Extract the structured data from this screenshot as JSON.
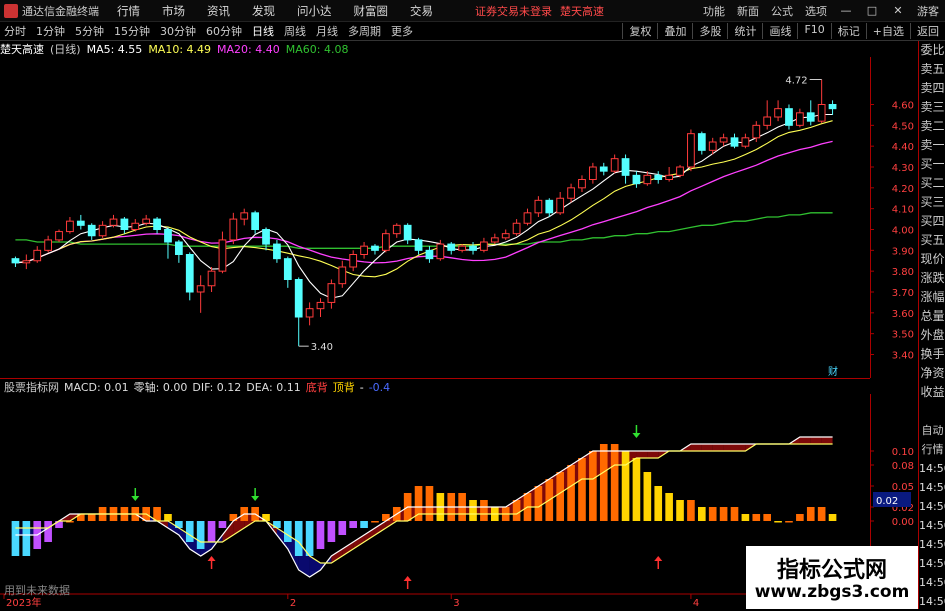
{
  "titlebar": {
    "app_title": "通达信金融终端",
    "menu": [
      "行情",
      "市场",
      "资讯",
      "发现",
      "问小达",
      "财富圈",
      "交易"
    ],
    "warning": "证券交易未登录",
    "warning2": "楚天高速",
    "right": [
      "功能",
      "新面",
      "公式",
      "选项"
    ],
    "guest": "游客",
    "win_min": "—",
    "win_max": "□",
    "win_close": "✕"
  },
  "toolbar": {
    "periods": [
      "分时",
      "1分钟",
      "5分钟",
      "15分钟",
      "30分钟",
      "60分钟",
      "日线",
      "周线",
      "月线",
      "多周期",
      "更多"
    ],
    "active_period": "日线",
    "right": [
      "复权",
      "叠加",
      "多股",
      "统计",
      "画线",
      "F10",
      "标记",
      "+自选",
      "返回"
    ]
  },
  "infobar": {
    "stock": "楚天高速",
    "period": "(日线)",
    "ma5": "MA5: 4.55",
    "ma10": "MA10: 4.49",
    "ma20": "MA20: 4.40",
    "ma60": "MA60: 4.08"
  },
  "indicator_bar": {
    "name": "股票指标网",
    "macd": "MACD: 0.01",
    "zero": "零轴: 0.00",
    "dif": "DIF: 0.12",
    "dea": "DEA: 0.11",
    "lbl1": "底背",
    "lbl2": "顶背",
    "lbl3": "-",
    "lbl4": "-0.4"
  },
  "rightcol": [
    "委比",
    "卖五",
    "卖四",
    "卖三",
    "卖二",
    "卖一",
    "买一",
    "买二",
    "买三",
    "买四",
    "买五",
    "现价",
    "涨跌",
    "涨幅",
    "总量",
    "外盘",
    "换手",
    "净资",
    "收益",
    "",
    "自动",
    "行情",
    "14:50",
    "14:50",
    "14:50",
    "14:50",
    "14:50",
    "14:50",
    "14:50",
    "14:50"
  ],
  "price_axis": [
    "4.60",
    "4.50",
    "4.40",
    "4.30",
    "4.20",
    "4.10",
    "4.00",
    "3.90",
    "3.80",
    "3.70",
    "3.60",
    "3.50",
    "3.40"
  ],
  "macd_axis": [
    "0.10",
    "0.08",
    "0.05",
    "0.02",
    "0.00"
  ],
  "macd_current": "0.02",
  "annotations": {
    "high": "4.72",
    "low": "3.40",
    "fin": "财"
  },
  "date_axis": [
    "2023年",
    "2",
    "3",
    "4"
  ],
  "footnote": "用到未来数据",
  "watermark": {
    "line1": "指标公式网",
    "line2": "www.zbgs3.com"
  },
  "colors": {
    "up": "#ff3b3b",
    "down": "#54ffff",
    "ma5": "#ffffff",
    "ma10": "#ffff55",
    "ma20": "#ff40ff",
    "ma60": "#30c030",
    "macd_up": "#ff6a00",
    "macd_up2": "#ffd400",
    "macd_dn": "#4ad8ff",
    "macd_dn2": "#c050ff"
  },
  "chart_data": {
    "type": "candlestick",
    "ylim": [
      3.34,
      4.78
    ],
    "candles": [
      [
        3.86,
        3.84,
        3.87,
        3.82
      ],
      [
        3.84,
        3.85,
        3.88,
        3.81
      ],
      [
        3.85,
        3.9,
        3.92,
        3.84
      ],
      [
        3.9,
        3.95,
        3.97,
        3.89
      ],
      [
        3.95,
        3.99,
        4.0,
        3.94
      ],
      [
        3.99,
        4.04,
        4.06,
        3.98
      ],
      [
        4.04,
        4.02,
        4.07,
        4.0
      ],
      [
        4.02,
        3.97,
        4.03,
        3.95
      ],
      [
        3.97,
        4.02,
        4.04,
        3.96
      ],
      [
        4.02,
        4.05,
        4.07,
        4.01
      ],
      [
        4.05,
        4.0,
        4.06,
        3.98
      ],
      [
        4.0,
        4.03,
        4.05,
        3.99
      ],
      [
        4.03,
        4.05,
        4.07,
        4.02
      ],
      [
        4.05,
        4.0,
        4.06,
        3.98
      ],
      [
        4.0,
        3.94,
        4.01,
        3.86
      ],
      [
        3.94,
        3.88,
        3.95,
        3.84
      ],
      [
        3.88,
        3.7,
        3.89,
        3.66
      ],
      [
        3.7,
        3.73,
        3.78,
        3.6
      ],
      [
        3.73,
        3.8,
        3.82,
        3.7
      ],
      [
        3.8,
        3.95,
        3.99,
        3.79
      ],
      [
        3.95,
        4.05,
        4.08,
        3.93
      ],
      [
        4.05,
        4.08,
        4.1,
        4.02
      ],
      [
        4.08,
        4.0,
        4.09,
        3.98
      ],
      [
        4.0,
        3.93,
        4.01,
        3.9
      ],
      [
        3.93,
        3.86,
        3.95,
        3.84
      ],
      [
        3.86,
        3.76,
        3.87,
        3.72
      ],
      [
        3.76,
        3.58,
        3.77,
        3.44
      ],
      [
        3.58,
        3.62,
        3.65,
        3.54
      ],
      [
        3.62,
        3.65,
        3.67,
        3.58
      ],
      [
        3.65,
        3.74,
        3.76,
        3.62
      ],
      [
        3.74,
        3.82,
        3.85,
        3.72
      ],
      [
        3.82,
        3.88,
        3.9,
        3.8
      ],
      [
        3.88,
        3.92,
        3.94,
        3.86
      ],
      [
        3.92,
        3.9,
        3.93,
        3.88
      ],
      [
        3.9,
        3.98,
        4.0,
        3.89
      ],
      [
        3.98,
        4.02,
        4.03,
        3.96
      ],
      [
        4.02,
        3.95,
        4.03,
        3.93
      ],
      [
        3.95,
        3.9,
        3.96,
        3.88
      ],
      [
        3.9,
        3.86,
        3.92,
        3.84
      ],
      [
        3.86,
        3.93,
        3.95,
        3.85
      ],
      [
        3.93,
        3.9,
        3.94,
        3.88
      ],
      [
        3.9,
        3.92,
        3.93,
        3.89
      ],
      [
        3.92,
        3.9,
        3.94,
        3.88
      ],
      [
        3.9,
        3.94,
        3.96,
        3.89
      ],
      [
        3.94,
        3.96,
        3.98,
        3.93
      ],
      [
        3.96,
        3.98,
        4.0,
        3.95
      ],
      [
        3.98,
        4.03,
        4.05,
        3.97
      ],
      [
        4.03,
        4.08,
        4.1,
        4.02
      ],
      [
        4.08,
        4.14,
        4.16,
        4.06
      ],
      [
        4.14,
        4.08,
        4.15,
        4.06
      ],
      [
        4.08,
        4.15,
        4.18,
        4.07
      ],
      [
        4.15,
        4.2,
        4.22,
        4.13
      ],
      [
        4.2,
        4.24,
        4.26,
        4.18
      ],
      [
        4.24,
        4.3,
        4.32,
        4.22
      ],
      [
        4.3,
        4.28,
        4.32,
        4.26
      ],
      [
        4.28,
        4.34,
        4.36,
        4.27
      ],
      [
        4.34,
        4.26,
        4.36,
        4.22
      ],
      [
        4.26,
        4.22,
        4.28,
        4.2
      ],
      [
        4.22,
        4.26,
        4.28,
        4.21
      ],
      [
        4.26,
        4.24,
        4.28,
        4.22
      ],
      [
        4.24,
        4.26,
        4.3,
        4.23
      ],
      [
        4.26,
        4.3,
        4.31,
        4.25
      ],
      [
        4.3,
        4.46,
        4.48,
        4.28
      ],
      [
        4.46,
        4.38,
        4.47,
        4.36
      ],
      [
        4.38,
        4.42,
        4.44,
        4.36
      ],
      [
        4.42,
        4.44,
        4.46,
        4.4
      ],
      [
        4.44,
        4.4,
        4.46,
        4.39
      ],
      [
        4.4,
        4.44,
        4.46,
        4.39
      ],
      [
        4.44,
        4.5,
        4.52,
        4.42
      ],
      [
        4.5,
        4.54,
        4.62,
        4.48
      ],
      [
        4.54,
        4.58,
        4.62,
        4.52
      ],
      [
        4.58,
        4.5,
        4.6,
        4.48
      ],
      [
        4.5,
        4.56,
        4.58,
        4.49
      ],
      [
        4.56,
        4.52,
        4.62,
        4.5
      ],
      [
        4.52,
        4.6,
        4.72,
        4.51
      ],
      [
        4.6,
        4.58,
        4.62,
        4.55
      ]
    ],
    "ma60": [
      3.95,
      3.95,
      3.94,
      3.94,
      3.94,
      3.94,
      3.93,
      3.93,
      3.93,
      3.93,
      3.93,
      3.93,
      3.93,
      3.93,
      3.93,
      3.92,
      3.92,
      3.92,
      3.92,
      3.92,
      3.92,
      3.92,
      3.92,
      3.92,
      3.92,
      3.92,
      3.91,
      3.91,
      3.91,
      3.91,
      3.91,
      3.91,
      3.91,
      3.91,
      3.92,
      3.92,
      3.92,
      3.92,
      3.92,
      3.92,
      3.92,
      3.92,
      3.92,
      3.93,
      3.93,
      3.93,
      3.93,
      3.93,
      3.94,
      3.94,
      3.94,
      3.95,
      3.95,
      3.96,
      3.96,
      3.97,
      3.97,
      3.98,
      3.98,
      3.99,
      3.99,
      4.0,
      4.01,
      4.02,
      4.02,
      4.03,
      4.04,
      4.04,
      4.05,
      4.06,
      4.06,
      4.07,
      4.07,
      4.08,
      4.08,
      4.08
    ],
    "macd": [
      -0.05,
      -0.05,
      -0.04,
      -0.03,
      -0.01,
      0.0,
      0.01,
      0.01,
      0.02,
      0.02,
      0.02,
      0.02,
      0.02,
      0.02,
      0.01,
      -0.01,
      -0.03,
      -0.04,
      -0.03,
      -0.01,
      0.01,
      0.02,
      0.02,
      0.01,
      -0.01,
      -0.03,
      -0.05,
      -0.05,
      -0.04,
      -0.03,
      -0.02,
      -0.01,
      -0.01,
      0.0,
      0.01,
      0.02,
      0.04,
      0.05,
      0.05,
      0.04,
      0.04,
      0.04,
      0.03,
      0.03,
      0.02,
      0.02,
      0.03,
      0.04,
      0.05,
      0.06,
      0.07,
      0.08,
      0.09,
      0.1,
      0.11,
      0.11,
      0.1,
      0.09,
      0.07,
      0.05,
      0.04,
      0.03,
      0.03,
      0.02,
      0.02,
      0.02,
      0.02,
      0.01,
      0.01,
      0.01,
      0.0,
      0.0,
      0.01,
      0.02,
      0.02,
      0.01
    ],
    "dif": [
      -0.02,
      -0.02,
      -0.02,
      -0.01,
      0.0,
      0.01,
      0.01,
      0.01,
      0.01,
      0.01,
      0.01,
      0.01,
      0.0,
      0.0,
      -0.01,
      -0.02,
      -0.04,
      -0.05,
      -0.04,
      -0.02,
      0.0,
      0.01,
      0.01,
      0.0,
      -0.02,
      -0.04,
      -0.07,
      -0.08,
      -0.07,
      -0.05,
      -0.04,
      -0.03,
      -0.02,
      -0.01,
      0.0,
      0.01,
      0.02,
      0.02,
      0.02,
      0.02,
      0.02,
      0.02,
      0.02,
      0.02,
      0.02,
      0.02,
      0.03,
      0.04,
      0.05,
      0.06,
      0.07,
      0.08,
      0.09,
      0.1,
      0.1,
      0.1,
      0.1,
      0.1,
      0.1,
      0.1,
      0.1,
      0.1,
      0.11,
      0.11,
      0.11,
      0.11,
      0.11,
      0.11,
      0.11,
      0.11,
      0.11,
      0.11,
      0.12,
      0.12,
      0.12,
      0.12
    ],
    "dea": [
      -0.01,
      -0.01,
      -0.01,
      -0.01,
      0.0,
      0.0,
      0.01,
      0.01,
      0.01,
      0.01,
      0.01,
      0.01,
      0.01,
      0.0,
      0.0,
      -0.01,
      -0.02,
      -0.03,
      -0.03,
      -0.03,
      -0.02,
      -0.01,
      0.0,
      0.0,
      -0.01,
      -0.02,
      -0.03,
      -0.05,
      -0.06,
      -0.06,
      -0.05,
      -0.04,
      -0.03,
      -0.02,
      -0.01,
      0.0,
      0.0,
      0.01,
      0.01,
      0.01,
      0.01,
      0.01,
      0.01,
      0.01,
      0.01,
      0.01,
      0.01,
      0.02,
      0.02,
      0.03,
      0.04,
      0.05,
      0.06,
      0.06,
      0.07,
      0.08,
      0.08,
      0.09,
      0.09,
      0.09,
      0.1,
      0.1,
      0.1,
      0.1,
      0.1,
      0.1,
      0.1,
      0.1,
      0.11,
      0.11,
      0.11,
      0.11,
      0.11,
      0.11,
      0.11,
      0.11
    ]
  }
}
